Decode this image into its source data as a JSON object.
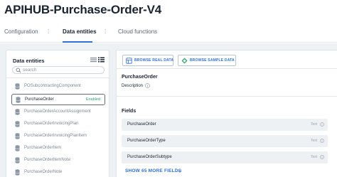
{
  "app": {
    "title": "APIHUB-Purchase-Order-V4"
  },
  "tabs": [
    {
      "label": "Configuration",
      "active": false
    },
    {
      "label": "Data entities",
      "active": true
    },
    {
      "label": "Cloud functions",
      "active": false
    }
  ],
  "sidebar": {
    "header": "Data entities",
    "search": {
      "placeholder": "search",
      "value": ""
    },
    "items": [
      {
        "label": "POSubcontractingComponent",
        "status": ""
      },
      {
        "label": "PurchaseOrder",
        "status": "Enabled",
        "selected": true
      },
      {
        "label": "PurchaseOrderAccountAssignment",
        "status": ""
      },
      {
        "label": "PurchaseOrderInvoicingPlan",
        "status": ""
      },
      {
        "label": "PurchaseOrderInvoicingPlanItem",
        "status": ""
      },
      {
        "label": "PurchaseOrderItem",
        "status": ""
      },
      {
        "label": "PurchaseOrderItemNote",
        "status": ""
      },
      {
        "label": "PurchaseOrderNote",
        "status": ""
      }
    ]
  },
  "toolbar": {
    "browse_real": "BROWSE REAL DATA",
    "browse_sample": "BROWSE SAMPLE DATA"
  },
  "entity": {
    "title": "PurchaseOrder",
    "description_label": "Description"
  },
  "fields": {
    "title": "Fields",
    "rows": [
      {
        "name": "PurchaseOrder",
        "type": "Text"
      },
      {
        "name": "PurchaseOrderType",
        "type": "Text"
      },
      {
        "name": "PurchaseOrderSubtype",
        "type": "Text"
      }
    ],
    "show_more": "SHOW 65 MORE FIELDS"
  },
  "colors": {
    "accent": "#2f6fdd",
    "enabled": "#2fa36b",
    "panel_bg": "#eef1f4"
  },
  "icons": [
    "list-view-icon",
    "table-view-icon",
    "search-icon",
    "database-icon",
    "browse-real-data-icon",
    "browse-sample-data-icon",
    "info-icon",
    "chevron-down-icon"
  ]
}
